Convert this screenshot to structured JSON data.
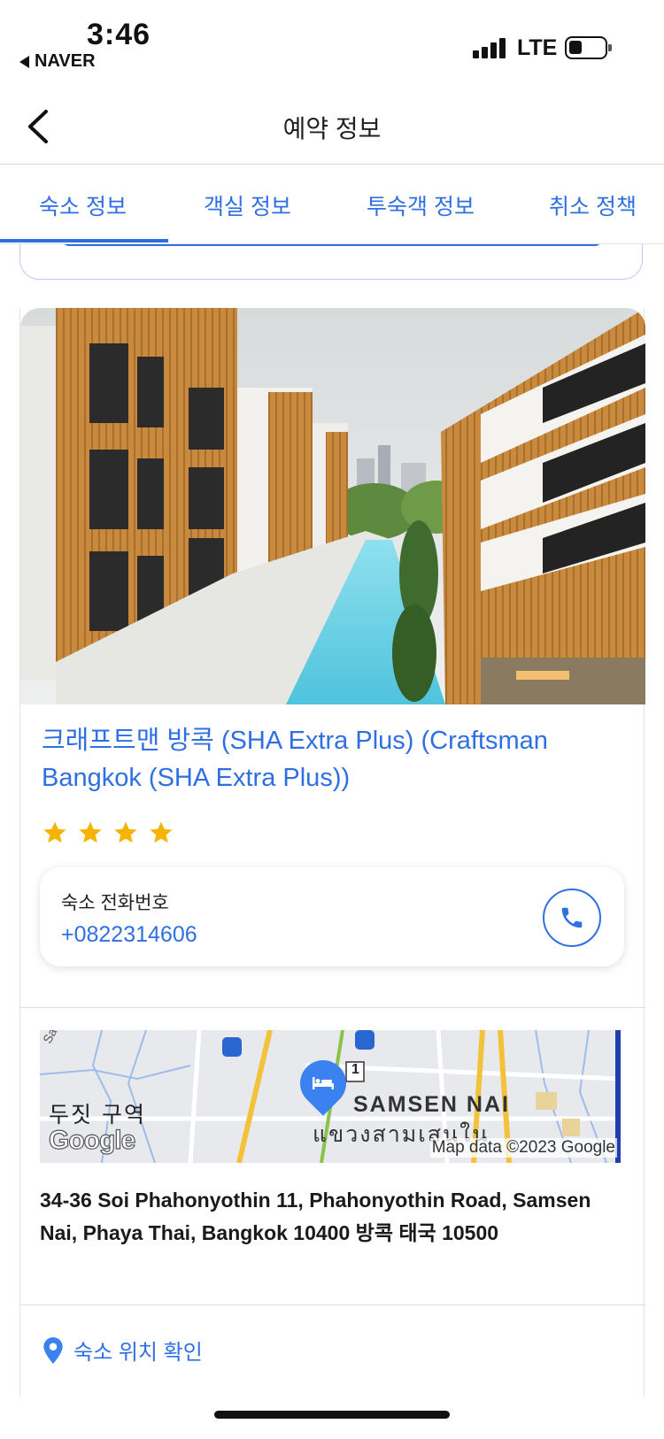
{
  "status_bar": {
    "time": "3:46",
    "back_app": "NAVER",
    "network": "LTE"
  },
  "header": {
    "title": "예약 정보"
  },
  "tabs": [
    {
      "label": "숙소 정보",
      "active": true
    },
    {
      "label": "객실 정보",
      "active": false
    },
    {
      "label": "투숙객 정보",
      "active": false
    },
    {
      "label": "취소 정책",
      "active": false
    }
  ],
  "hotel": {
    "name": "크래프트맨 방콕 (SHA Extra Plus) (Craftsman Bangkok (SHA Extra Plus))",
    "star_rating": 4,
    "phone_label": "숙소 전화번호",
    "phone_number": "+0822314606",
    "address": "34-36 Soi Phahonyothin 11, Phahonyothin Road, Samsen Nai, Phaya Thai, Bangkok 10400 방콕 태국 10500",
    "location_link": "숙소 위치 확인"
  },
  "map": {
    "street_label": "Samsen",
    "district_label": "두짓 구역",
    "area_label": "SAMSEN NAI",
    "area_label_thai": "แขวงสามเสนใน",
    "logo_text": "Google",
    "credit": "Map data ©2023 Google",
    "route_badge": "1"
  },
  "colors": {
    "accent": "#2f6fe4",
    "star": "#f4b400",
    "pool": "#6fd3e6",
    "facade_wood": "#c98a3e"
  },
  "icons": {
    "back": "chevron-left-icon",
    "phone": "phone-icon",
    "location": "location-pin-icon",
    "hotel_marker": "bed-icon"
  }
}
